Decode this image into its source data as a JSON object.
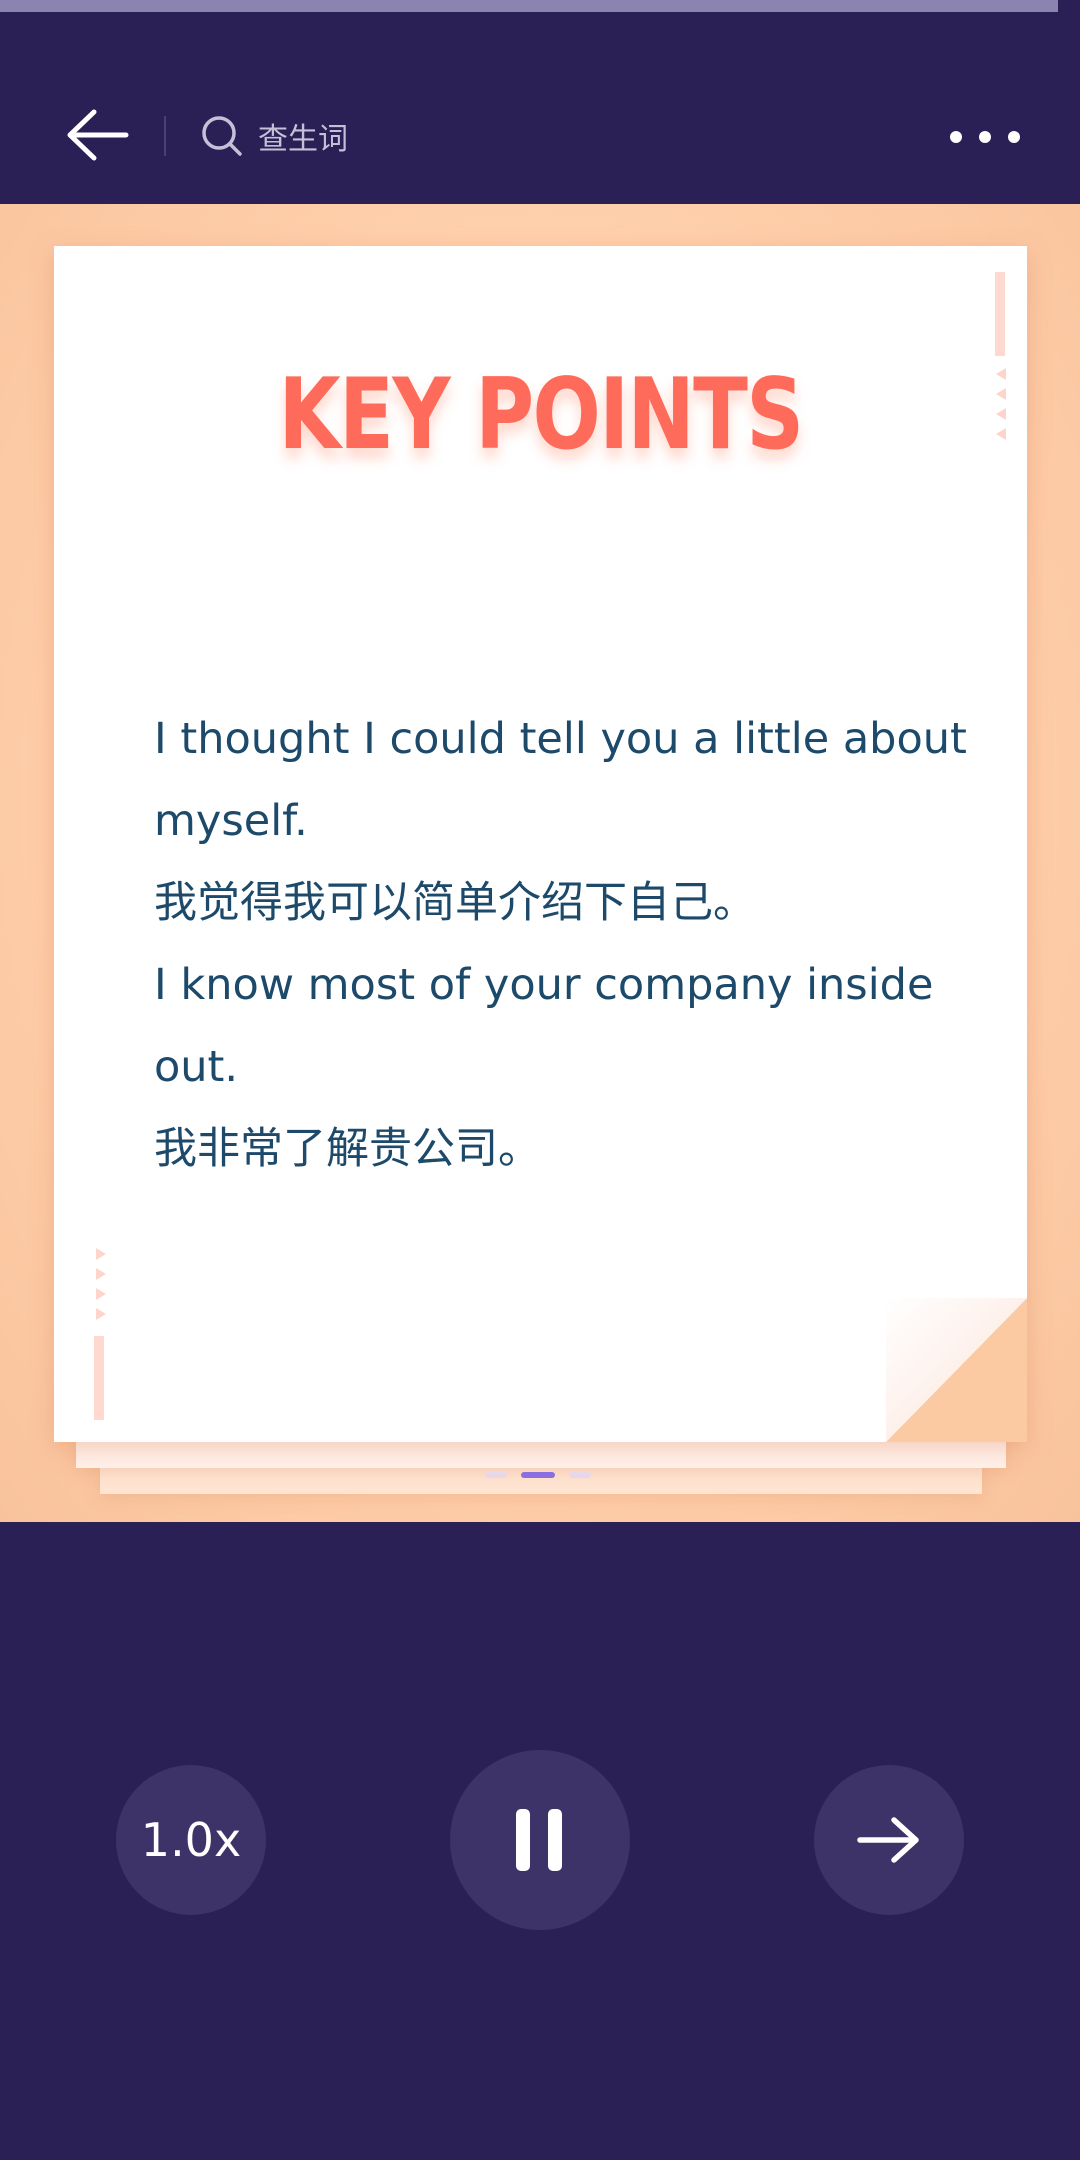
{
  "progress": {
    "fraction": 0.98
  },
  "header": {
    "search_label": "查生词"
  },
  "card": {
    "title": "KEY POINTS",
    "lines": [
      "I thought I could tell you a little about",
      "myself.",
      "我觉得我可以简单介绍下自己。",
      "I know most of your company inside",
      "out.",
      "我非常了解贵公司。"
    ],
    "page_indicator": {
      "total": 3,
      "current": 2
    }
  },
  "controls": {
    "speed_label": "1.0x"
  },
  "colors": {
    "background": "#2b2055",
    "title": "#ff6b5b",
    "text": "#1d4a6a",
    "card_backdrop": "#ffd0ac",
    "control_bg": "#3e3368",
    "active_dot": "#8a6fe0"
  },
  "icons": {
    "back": "arrow-left-icon",
    "search": "search-icon",
    "more": "more-dots-icon",
    "pause": "pause-icon",
    "next": "arrow-right-icon"
  }
}
